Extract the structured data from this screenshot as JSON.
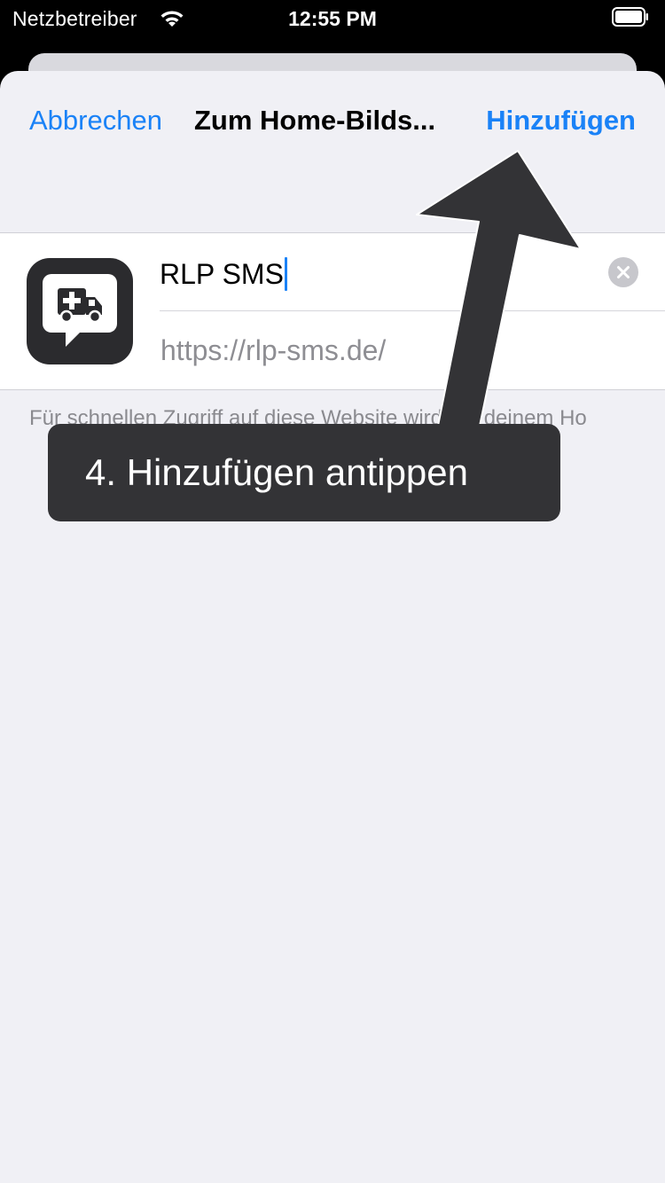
{
  "status_bar": {
    "carrier": "Netzbetreiber",
    "time": "12:55 PM",
    "icons": [
      "wifi-icon",
      "battery-icon"
    ]
  },
  "nav": {
    "cancel_label": "Abbrechen",
    "title": "Zum Home-Bilds...",
    "add_label": "Hinzufügen"
  },
  "form": {
    "app_icon": "ambulance-chat-icon",
    "name_value": "RLP SMS",
    "url": "https://rlp-sms.de/",
    "clear_icon": "clear-icon"
  },
  "footnote": "Für schnellen Zugriff auf diese Website wird auf deinem Ho",
  "annotation": {
    "callout_text": "4. Hinzufügen antippen"
  },
  "colors": {
    "accent": "#1a82f7",
    "sheet_background": "#f0f0f5",
    "callout_background": "#333336"
  }
}
